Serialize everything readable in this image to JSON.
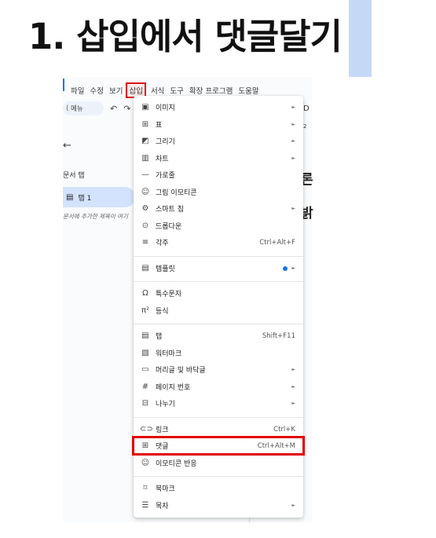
{
  "heading": "1. 삽입에서 댓글달기",
  "menubar": [
    "파일",
    "수정",
    "보기",
    "삽입",
    "서식",
    "도구",
    "확장 프로그램",
    "도움말"
  ],
  "toolbar": {
    "search_label": "메뉴",
    "undo": "↶",
    "redo": "↷"
  },
  "sidebar": {
    "back": "←",
    "doc_tabs_label": "문서 탭",
    "tab_label": "탭 1",
    "tab_hint": "문서에 추가한 제목이 여기"
  },
  "doc_fragments": {
    "edge_top": "D",
    "edge_small": "2",
    "glyph1": "론",
    "glyph2": "밝"
  },
  "menu": {
    "items": [
      {
        "icon": "▣",
        "label": "이미지",
        "arrow": "►"
      },
      {
        "icon": "⊞",
        "label": "표",
        "arrow": "►"
      },
      {
        "icon": "◩",
        "label": "그리기",
        "arrow": "►"
      },
      {
        "icon": "▥",
        "label": "차트",
        "arrow": "►"
      },
      {
        "icon": "—",
        "label": "가로줄"
      },
      {
        "icon": "☺",
        "label": "그림 이모티콘"
      },
      {
        "icon": "⚙",
        "label": "스마트 칩",
        "arrow": "►"
      },
      {
        "icon": "⊙",
        "label": "드롭다운"
      },
      {
        "icon": "≡",
        "label": "각주",
        "shortcut": "Ctrl+Alt+F"
      },
      {
        "icon": "▤",
        "label": "템플릿",
        "arrow": "►",
        "dot": true
      },
      {
        "icon": "Ω",
        "label": "특수문자"
      },
      {
        "icon": "π²",
        "label": "등식"
      },
      {
        "icon": "▤",
        "label": "탭",
        "shortcut": "Shift+F11"
      },
      {
        "icon": "▧",
        "label": "워터마크"
      },
      {
        "icon": "▭",
        "label": "머리글 및 바닥글",
        "arrow": "►"
      },
      {
        "icon": "#",
        "label": "페이지 번호",
        "arrow": "►"
      },
      {
        "icon": "⊟",
        "label": "나누기",
        "arrow": "►"
      },
      {
        "icon": "⊂⊃",
        "label": "링크",
        "shortcut": "Ctrl+K"
      },
      {
        "icon": "⊞",
        "label": "댓글",
        "shortcut": "Ctrl+Alt+M",
        "highlighted": true
      },
      {
        "icon": "☺",
        "label": "이모티콘 반응"
      },
      {
        "icon": "⌑",
        "label": "북마크"
      },
      {
        "icon": "☰",
        "label": "목차",
        "arrow": "►"
      }
    ]
  },
  "colors": {
    "highlight": "#e00000",
    "accent": "#c5d9f7",
    "selected_tab": "#d3e3fd",
    "link_blue": "#1a73e8"
  }
}
